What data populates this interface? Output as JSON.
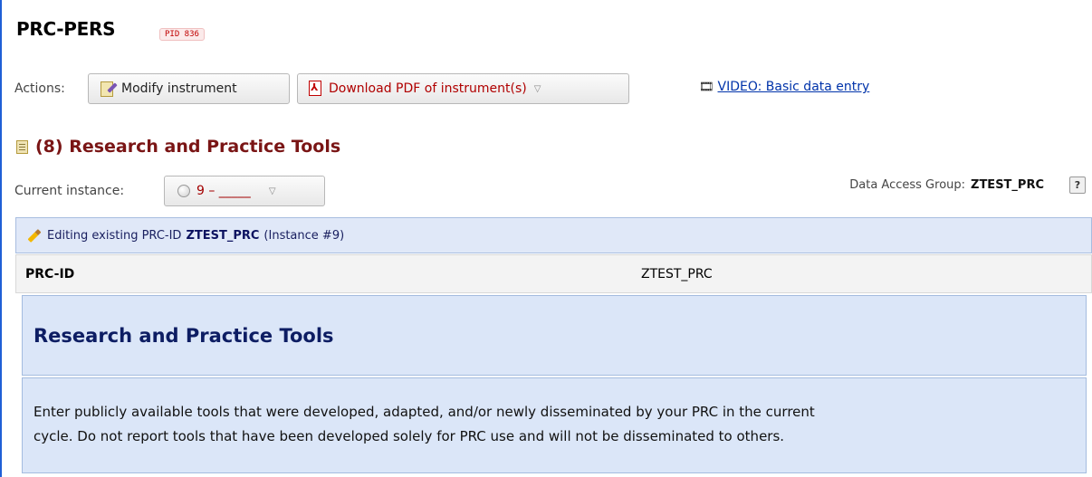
{
  "project": {
    "title": "PRC-PERS",
    "pid": "PID 836"
  },
  "actions": {
    "label": "Actions:",
    "modify_label": "Modify instrument",
    "pdf_label": "Download PDF of instrument(s)",
    "video_label": "VIDEO: Basic data entry"
  },
  "form": {
    "title": "(8) Research and Practice Tools"
  },
  "instance": {
    "label": "Current instance:",
    "value": "9 – _____"
  },
  "dag": {
    "label": "Data Access Group:",
    "value": "ZTEST_PRC",
    "help": "?"
  },
  "edit_bar": {
    "prefix": "Editing existing PRC-ID",
    "record": "ZTEST_PRC",
    "suffix": "(Instance #9)"
  },
  "field": {
    "label": "PRC-ID",
    "value": "ZTEST_PRC"
  },
  "section": {
    "title": "Research and Practice Tools",
    "description_line1": "Enter publicly available tools that were developed, adapted, and/or newly disseminated by your PRC in the current",
    "description_line2": "cycle. Do not report tools that have been developed solely for PRC use and will not be disseminated to others."
  },
  "colors": {
    "accent_blue": "#1f5fd6",
    "title_red": "#7a1515",
    "section_bg": "#dbe6f8"
  }
}
